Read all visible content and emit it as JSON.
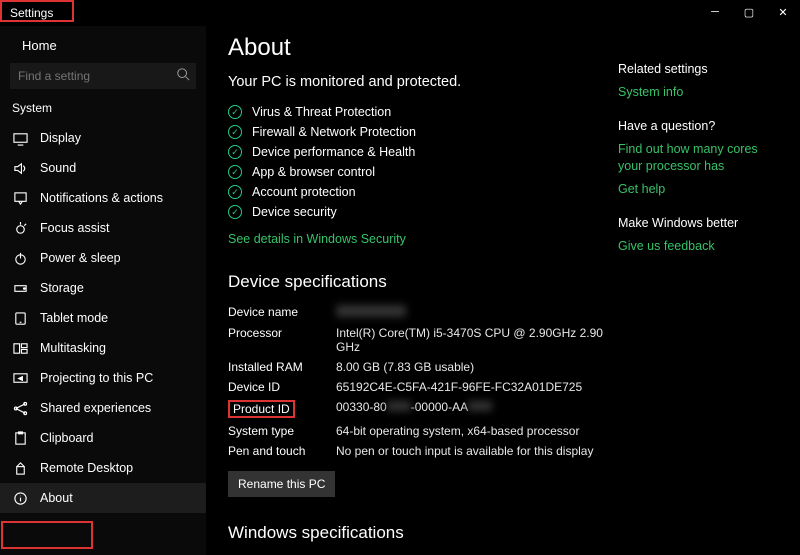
{
  "window": {
    "title": "Settings"
  },
  "sidebar": {
    "home": "Home",
    "search_placeholder": "Find a setting",
    "section": "System",
    "items": [
      {
        "label": "Display",
        "icon": "display"
      },
      {
        "label": "Sound",
        "icon": "sound"
      },
      {
        "label": "Notifications & actions",
        "icon": "notifications"
      },
      {
        "label": "Focus assist",
        "icon": "focus"
      },
      {
        "label": "Power & sleep",
        "icon": "power"
      },
      {
        "label": "Storage",
        "icon": "storage"
      },
      {
        "label": "Tablet mode",
        "icon": "tablet"
      },
      {
        "label": "Multitasking",
        "icon": "multitasking"
      },
      {
        "label": "Projecting to this PC",
        "icon": "projecting"
      },
      {
        "label": "Shared experiences",
        "icon": "shared"
      },
      {
        "label": "Clipboard",
        "icon": "clipboard"
      },
      {
        "label": "Remote Desktop",
        "icon": "remote"
      },
      {
        "label": "About",
        "icon": "about",
        "selected": true
      }
    ]
  },
  "main": {
    "title": "About",
    "monitored": "Your PC is monitored and protected.",
    "security_items": [
      "Virus & Threat Protection",
      "Firewall & Network Protection",
      "Device performance & Health",
      "App & browser control",
      "Account protection",
      "Device security"
    ],
    "security_link": "See details in Windows Security",
    "device_spec_heading": "Device specifications",
    "specs": {
      "device_name_label": "Device name",
      "device_name_value": "(redacted)",
      "processor_label": "Processor",
      "processor_value": "Intel(R) Core(TM) i5-3470S CPU @ 2.90GHz   2.90 GHz",
      "ram_label": "Installed RAM",
      "ram_value": "8.00 GB (7.83 GB usable)",
      "device_id_label": "Device ID",
      "device_id_value": "65192C4E-C5FA-421F-96FE-FC32A01DE725",
      "product_id_label": "Product ID",
      "product_id_value": "00330-80▮▮▮-00000-AA▮▮▮",
      "system_type_label": "System type",
      "system_type_value": "64-bit operating system, x64-based processor",
      "pen_label": "Pen and touch",
      "pen_value": "No pen or touch input is available for this display"
    },
    "rename_button": "Rename this PC",
    "windows_spec_heading": "Windows specifications"
  },
  "rail": {
    "related_heading": "Related settings",
    "related_link": "System info",
    "question_heading": "Have a question?",
    "question_link1": "Find out how many cores your processor has",
    "question_link2": "Get help",
    "improve_heading": "Make Windows better",
    "improve_link": "Give us feedback"
  }
}
